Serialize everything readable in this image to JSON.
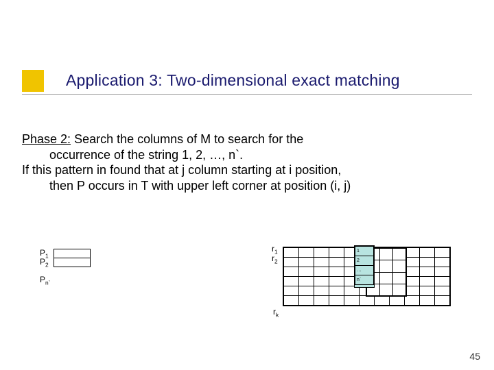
{
  "title": "Application 3: Two-dimensional exact matching",
  "phase_label": "Phase 2:",
  "body_line1_rest": " Search the columns of M to search for the",
  "body_line2": "occurrence of the string 1, 2, …, n`.",
  "body_line3": "If this pattern in found that at j column starting at i position,",
  "body_line4": "then P occurs in T with upper left corner at position  (i, j)",
  "p_labels": {
    "p1": "P",
    "p1_sub": "1",
    "p2": "P",
    "p2_sub": "2",
    "pn": "P",
    "pn_sub": "n`"
  },
  "r_labels": {
    "r1": "r",
    "r1_sub": "1",
    "r2": "r",
    "r2_sub": "2",
    "rk": "r",
    "rk_sub": "k"
  },
  "hi_cells": [
    "1",
    "2",
    "…",
    "n`"
  ],
  "page_number": "45"
}
